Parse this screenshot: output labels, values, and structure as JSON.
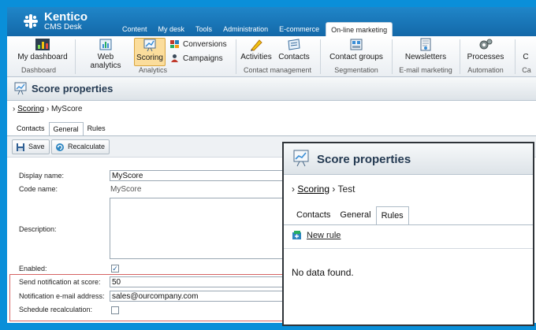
{
  "app": {
    "logo_title": "Kentico",
    "logo_subtitle": "CMS Desk"
  },
  "main_tabs": [
    {
      "label": "Content"
    },
    {
      "label": "My desk"
    },
    {
      "label": "Tools"
    },
    {
      "label": "Administration"
    },
    {
      "label": "E-commerce"
    },
    {
      "label": "On-line marketing"
    }
  ],
  "ribbon": {
    "my_dashboard": "My dashboard",
    "dashboard_group": "Dashboard",
    "web_analytics": "Web analytics",
    "scoring": "Scoring",
    "conversions": "Conversions",
    "campaigns": "Campaigns",
    "analytics_group": "Analytics",
    "activities": "Activities",
    "contacts": "Contacts",
    "contact_management_group": "Contact management",
    "contact_groups": "Contact groups",
    "segmentation_group": "Segmentation",
    "newsletters": "Newsletters",
    "email_marketing_group": "E-mail marketing",
    "processes": "Processes",
    "automation_group": "Automation",
    "cut_label": "C",
    "cut_group": "Ca"
  },
  "page": {
    "title": "Score properties",
    "breadcrumb_link": "Scoring",
    "breadcrumb_current": "MyScore",
    "tabs": [
      {
        "label": "Contacts"
      },
      {
        "label": "General"
      },
      {
        "label": "Rules"
      }
    ],
    "save_label": "Save",
    "recalculate_label": "Recalculate"
  },
  "form": {
    "display_name_label": "Display name:",
    "display_name_value": "MyScore",
    "code_name_label": "Code name:",
    "code_name_value": "MyScore",
    "description_label": "Description:",
    "enabled_label": "Enabled:",
    "enabled_checked": true,
    "send_notification_label": "Send notification at score:",
    "send_notification_value": "50",
    "notification_email_label": "Notification e-mail address:",
    "notification_email_value": "sales@ourcompany.com",
    "schedule_recalc_label": "Schedule recalculation:",
    "schedule_recalc_checked": false
  },
  "popup": {
    "title": "Score properties",
    "breadcrumb_link": "Scoring",
    "breadcrumb_current": "Test",
    "tabs": [
      {
        "label": "Contacts"
      },
      {
        "label": "General"
      },
      {
        "label": "Rules"
      }
    ],
    "new_rule": "New rule",
    "empty_text": "No data found."
  },
  "colors": {
    "background": "#0a8fd9",
    "header": "#1468a8",
    "accent_highlight": "#fbdd9c",
    "frame_red": "#d66262"
  }
}
